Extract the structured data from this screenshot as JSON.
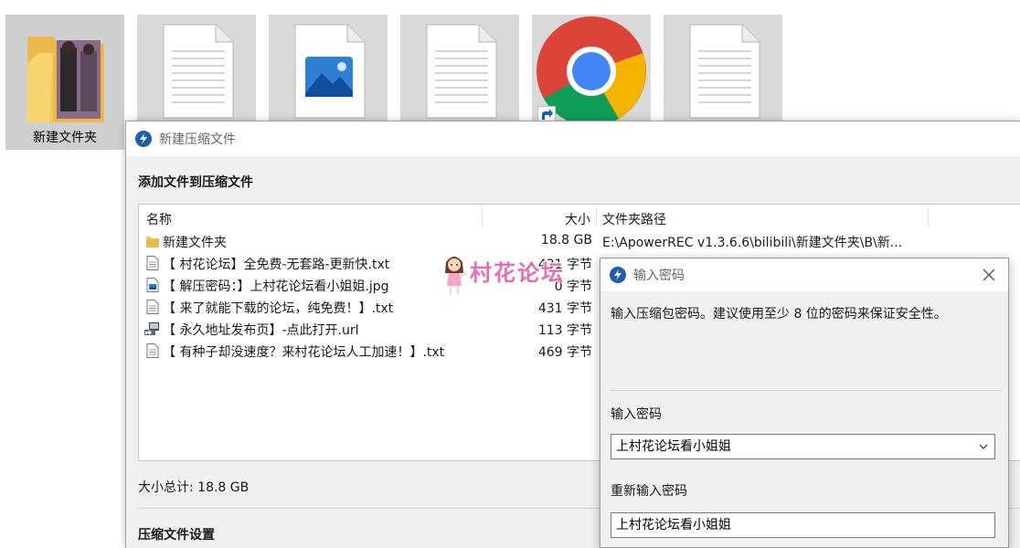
{
  "desktop": {
    "icons": [
      {
        "label": "新建文件夹",
        "type": "folder"
      },
      {
        "label": "",
        "type": "text-file"
      },
      {
        "label": "",
        "type": "image-file"
      },
      {
        "label": "",
        "type": "text-file"
      },
      {
        "label": "",
        "type": "chrome-shortcut"
      },
      {
        "label": "",
        "type": "text-file"
      }
    ]
  },
  "archive_window": {
    "title": "新建压缩文件",
    "section_add": "添加文件到压缩文件",
    "columns": {
      "name": "名称",
      "size": "大小",
      "path": "文件夹路径"
    },
    "files": [
      {
        "name": "新建文件夹",
        "size": "18.8 GB",
        "path": "E:\\ApowerREC v1.3.6.6\\bilibili\\新建文件夹\\B\\新...",
        "icon": "folder-icon"
      },
      {
        "name": "【 村花论坛】全免费-无套路-更新快.txt",
        "size": "431 字节",
        "path": "",
        "icon": "text-file-icon"
      },
      {
        "name": "【 解压密码：】上村花论坛看小姐姐.jpg",
        "size": "0 字节",
        "path": "",
        "icon": "image-file-icon"
      },
      {
        "name": "【 来了就能下载的论坛，纯免费！】.txt",
        "size": "431 字节",
        "path": "",
        "icon": "text-file-icon"
      },
      {
        "name": "【 永久地址发布页】-点此打开.url",
        "size": "113 字节",
        "path": "",
        "icon": "url-shortcut-icon"
      },
      {
        "name": "【 有种子却没速度？来村花论坛人工加速！】.txt",
        "size": "469 字节",
        "path": "",
        "icon": "text-file-icon"
      }
    ],
    "total": "大小总计: 18.8 GB",
    "section_settings": "压缩文件设置"
  },
  "watermark": {
    "text": "村花论坛"
  },
  "password_dialog": {
    "title": "输入密码",
    "description": "输入压缩包密码。建议使用至少 8 位的密码来保证安全性。",
    "password_label": "输入密码",
    "password_value": "上村花论坛看小姐姐",
    "confirm_label": "重新输入密码",
    "confirm_value": "上村花论坛看小姐姐"
  },
  "colors": {
    "accent": "#1e5fa8",
    "watermark": "#e46fb2",
    "folder": "#f3c857",
    "chrome_red": "#db4437",
    "chrome_green": "#0f9d58",
    "chrome_yellow": "#f4b400",
    "chrome_blue": "#4285f4"
  }
}
